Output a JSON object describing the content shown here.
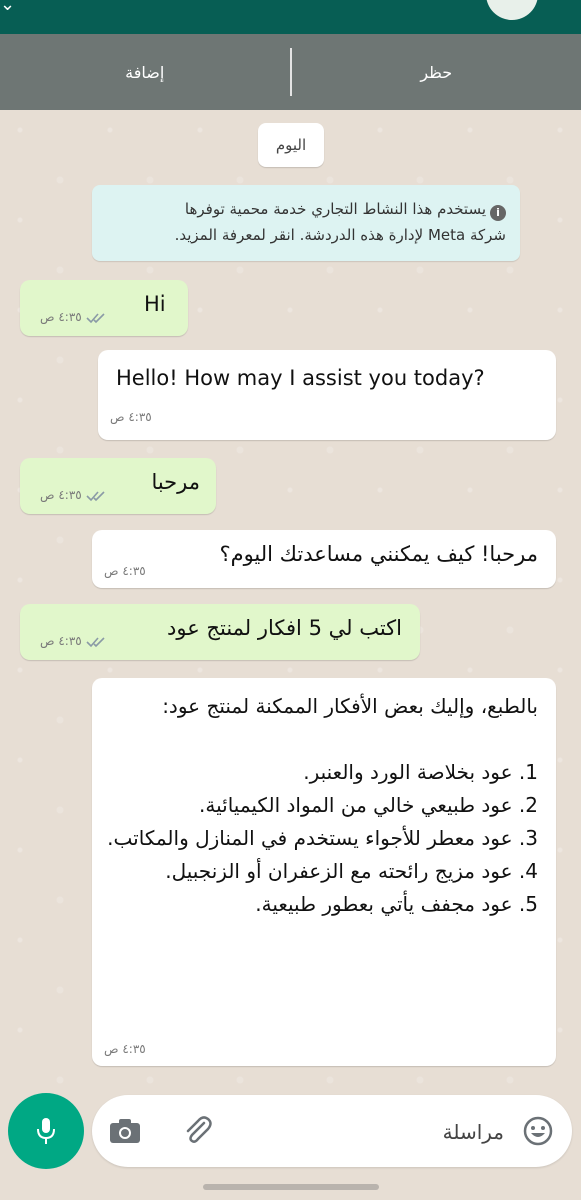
{
  "action_bar": {
    "block_label": "حظر",
    "add_label": "إضافة"
  },
  "date_chip": "اليوم",
  "system_notice": {
    "line1": "يستخدم هذا النشاط التجاري خدمة محمية توفرها",
    "line2": "شركة Meta لإدارة هذه الدردشة. انقر لمعرفة المزيد."
  },
  "messages": [
    {
      "direction": "out",
      "text": "Hi",
      "time": "٤:٣٥ ص"
    },
    {
      "direction": "in",
      "text": "Hello! How may I assist you today?",
      "time": "٤:٣٥ ص"
    },
    {
      "direction": "out",
      "text": "مرحبا",
      "time": "٤:٣٥ ص"
    },
    {
      "direction": "in",
      "text": "مرحبا! كيف يمكنني مساعدتك اليوم؟",
      "time": "٤:٣٥ ص"
    },
    {
      "direction": "out",
      "text": "اكتب لي 5 افكار لمنتج عود",
      "time": "٤:٣٥ ص"
    },
    {
      "direction": "in",
      "intro": "بالطبع، وإليك بعض الأفكار الممكنة لمنتج عود:",
      "items": [
        "1. عود بخلاصة الورد والعنبر.",
        "2. عود طبيعي خالي من المواد الكيميائية.",
        "3. عود معطر للأجواء يستخدم في المنازل والمكاتب.",
        "4. عود مزيج رائحته مع الزعفران أو الزنجبيل.",
        "5. عود مجفف يأتي بعطور طبيعية."
      ],
      "time": "٤:٣٥ ص"
    }
  ],
  "composer": {
    "placeholder": "مراسلة"
  },
  "colors": {
    "header": "#075e54",
    "action_bar": "#6e7674",
    "outgoing": "#e1f7cb",
    "incoming": "#ffffff",
    "notice": "#ddf3f2",
    "mic": "#00a884",
    "read_ticks": "#8a9aa6"
  },
  "icons": [
    "mic-icon",
    "camera-icon",
    "attach-icon",
    "emoji-icon",
    "info-icon",
    "double-check-icon"
  ]
}
